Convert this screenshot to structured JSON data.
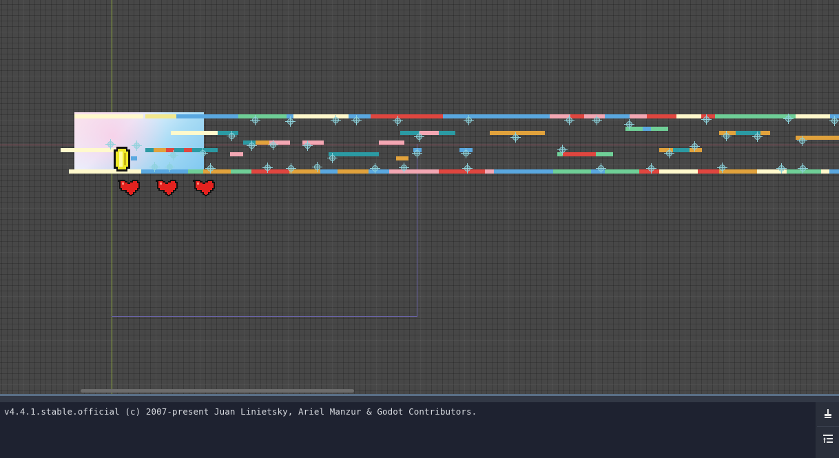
{
  "app": "Godot Engine",
  "editor": {
    "viewport": {
      "scene_objects": [
        "coin",
        "heart",
        "heart",
        "heart"
      ],
      "colors": {
        "yellow": "#f1e88d",
        "cream": "#fff9cc",
        "red": "#e0463f",
        "teal": "#2b9aa3",
        "orange": "#e1a23c",
        "green": "#6fcf97",
        "blue": "#5aa8e0",
        "pink": "#f3a7b3"
      }
    },
    "output": {
      "message": "v4.4.1.stable.official (c) 2007-present Juan Linietsky, Ariel Manzur & Godot Contributors."
    },
    "side_tools": {
      "clear_icon": "broom-icon",
      "filter_icon": "filter-lines-icon"
    }
  }
}
